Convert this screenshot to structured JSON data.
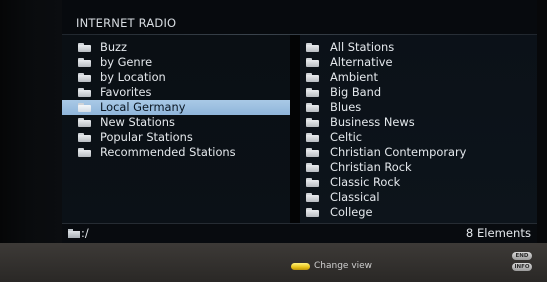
{
  "header": {
    "title": "INTERNET RADIO"
  },
  "left_list": {
    "items": [
      {
        "label": "Buzz"
      },
      {
        "label": "by Genre"
      },
      {
        "label": "by Location"
      },
      {
        "label": "Favorites"
      },
      {
        "label": "Local Germany",
        "selected": true
      },
      {
        "label": "New Stations"
      },
      {
        "label": "Popular Stations"
      },
      {
        "label": "Recommended Stations"
      }
    ]
  },
  "right_list": {
    "items": [
      {
        "label": "All Stations"
      },
      {
        "label": "Alternative"
      },
      {
        "label": "Ambient"
      },
      {
        "label": "Big Band"
      },
      {
        "label": "Blues"
      },
      {
        "label": "Business News"
      },
      {
        "label": "Celtic"
      },
      {
        "label": "Christian Contemporary"
      },
      {
        "label": "Christian Rock"
      },
      {
        "label": "Classic Rock"
      },
      {
        "label": "Classical"
      },
      {
        "label": "College"
      }
    ]
  },
  "status": {
    "path": ":/",
    "count": "8 Elements"
  },
  "footer": {
    "hint_label": "Change view",
    "hint_key_icon": "yellow-key-icon",
    "keys": [
      {
        "label": "END"
      },
      {
        "label": "INFO"
      }
    ]
  },
  "colors": {
    "selection": "#9fc1e2",
    "background": "#070a0e",
    "footer": "#34322f",
    "yellow_key": "#f0d23a"
  }
}
